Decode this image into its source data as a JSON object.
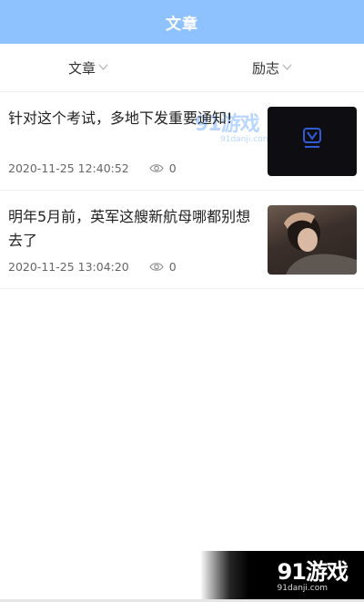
{
  "header": {
    "title": "文章"
  },
  "filters": {
    "left_label": "文章",
    "right_label": "励志"
  },
  "watermark": {
    "logo": "91游戏",
    "site": "91danji.com"
  },
  "articles": [
    {
      "title": "针对这个考试，多地下发重要通知!",
      "date": "2020-11-25 12:40:52",
      "views": "0",
      "thumb": "dark-logo"
    },
    {
      "title": "明年5月前，英军这艘新航母哪都别想去了",
      "date": "2020-11-25 13:04:20",
      "views": "0",
      "thumb": "photo"
    }
  ],
  "icons": {
    "chevron": "chevron-down-icon",
    "eye": "eye-icon"
  },
  "colors": {
    "header_bg": "#8ec2ff",
    "header_text": "#ffffff"
  }
}
